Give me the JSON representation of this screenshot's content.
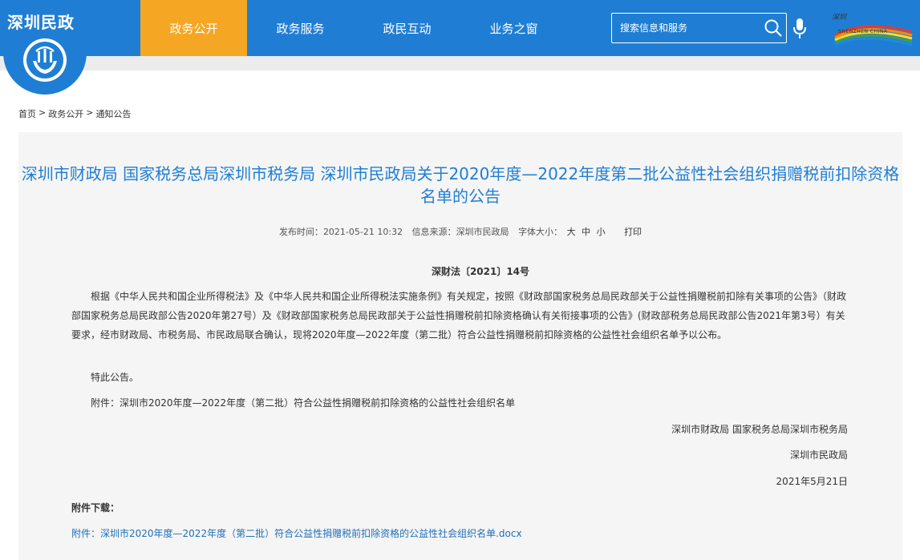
{
  "header": {
    "logo_text": "深圳民政",
    "nav": [
      {
        "label": "政务公开",
        "active": true
      },
      {
        "label": "政务服务",
        "active": false
      },
      {
        "label": "政民互动",
        "active": false
      },
      {
        "label": "业务之窗",
        "active": false
      }
    ],
    "search_placeholder": "搜索信息和服务",
    "brand_color": "#1f7ed4",
    "active_color": "#f5a623",
    "sz_logo_text": "深圳",
    "sz_logo_sub": "SHENZHEN CHINA"
  },
  "breadcrumb": [
    "首页",
    ">",
    "政务公开",
    ">",
    "通知公告"
  ],
  "article": {
    "title": "深圳市财政局 国家税务总局深圳市税务局 深圳市民政局关于2020年度—2022年度第二批公益性社会组织捐赠税前扣除资格名单的公告",
    "meta": {
      "publish_label": "发布时间：",
      "publish_time": "2021-05-21 10:32",
      "source_label": "信息来源：",
      "source": "深圳市民政局",
      "font_label": "字体大小：",
      "font_large": "大",
      "font_medium": "中",
      "font_small": "小",
      "print": "打印"
    },
    "doc_number": "深财法〔2021〕14号",
    "paragraphs": [
      "根据《中华人民共和国企业所得税法》及《中华人民共和国企业所得税法实施条例》有关规定，按照《财政部国家税务总局民政部关于公益性捐赠税前扣除有关事项的公告》（财政部国家税务总局民政部公告2020年第27号）及《财政部国家税务总局民政部关于公益性捐赠税前扣除资格确认有关衔接事项的公告》(财政部税务总局民政部公告2021年第3号）有关要求，经市财政局、市税务局、市民政局联合确认，现将2020年度—2022年度（第二批）符合公益性捐赠税前扣除资格的公益性社会组织名单予以公布。",
      "特此公告。",
      "附件：深圳市2020年度—2022年度（第二批）符合公益性捐赠税前扣除资格的公益性社会组织名单"
    ],
    "signatures": [
      "深圳市财政局 国家税务总局深圳市税务局",
      "深圳市民政局",
      "2021年5月21日"
    ],
    "download_title": "附件下载：",
    "download_link": "附件：深圳市2020年度—2022年度（第二批）符合公益性捐赠税前扣除资格的公益性社会组织名单.docx"
  }
}
